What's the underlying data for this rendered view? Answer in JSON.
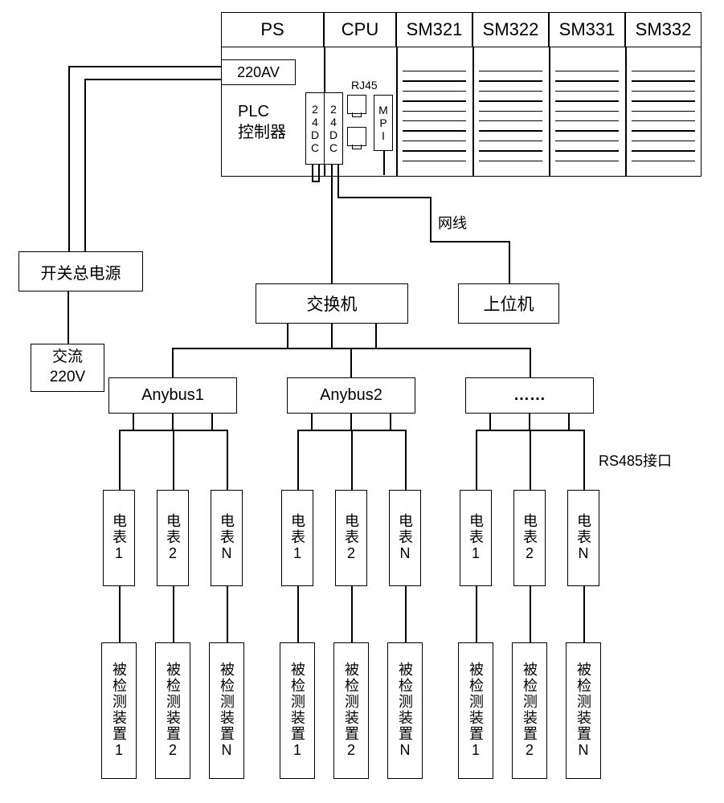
{
  "plc": {
    "headers": [
      "PS",
      "CPU",
      "SM321",
      "SM322",
      "SM331",
      "SM332"
    ],
    "ps_label": "220AV",
    "controller_label": "PLC\n控制器",
    "dc_label": "24DC",
    "rj45_label": "RJ45",
    "mpi_label": "MPI"
  },
  "power": {
    "main_switch": "开关总电源",
    "ac": "交流\n220V"
  },
  "network": {
    "switch": "交换机",
    "host": "上位机",
    "cable_label": "网线",
    "rs485_label": "RS485接口"
  },
  "anybus": [
    "Anybus1",
    "Anybus2",
    "……"
  ],
  "meters": {
    "group1": [
      "电表1",
      "电表2",
      "电表N"
    ],
    "group2": [
      "电表1",
      "电表2",
      "电表N"
    ],
    "group3": [
      "电表1",
      "电表2",
      "电表N"
    ]
  },
  "devices": {
    "group1": [
      "被检测装置1",
      "被检测装置2",
      "被检测装置N"
    ],
    "group2": [
      "被检测装置1",
      "被检测装置2",
      "被检测装置N"
    ],
    "group3": [
      "被检测装置1",
      "被检测装置2",
      "被检测装置N"
    ]
  }
}
